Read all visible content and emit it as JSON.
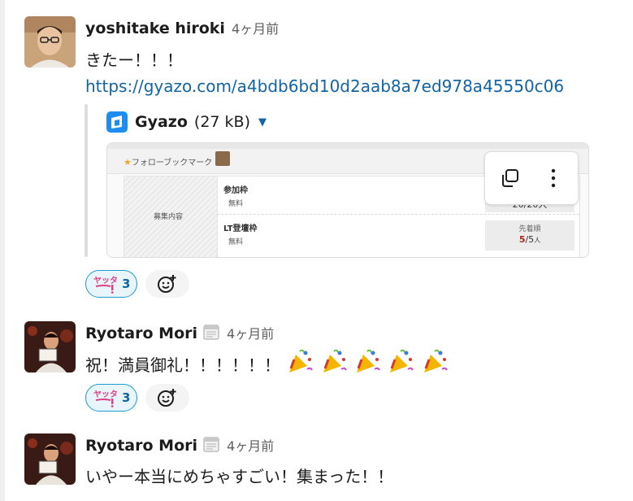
{
  "messages": [
    {
      "author": "yoshitake hiroki",
      "time": "4ヶ月前",
      "text": "きたー！！！",
      "link": "https://gyazo.com/a4bdb6bd10d2aab8a7ed978a45550c06",
      "attachment": {
        "service": "Gyazo",
        "size": "(27 kB)",
        "preview": {
          "favorite_label": "フォローブックマーク",
          "left_label": "募集内容",
          "rows": [
            {
              "title": "参加枠",
              "sub": "無料",
              "count_partial": "20/20人"
            },
            {
              "title": "LT登壇枠",
              "sub": "無料",
              "box_label": "先着順",
              "count_filled": "5",
              "count_total": "/5",
              "count_unit": "人"
            }
          ]
        }
      },
      "reaction": {
        "name": "ヤッタ",
        "count": "3"
      }
    },
    {
      "author": "Ryotaro Mori",
      "time": "4ヶ月前",
      "status_icon": "calendar-icon",
      "text": "祝！満員御礼！！！！！！",
      "emoji_trailing": "party-popper x5",
      "reaction": {
        "name": "ヤッタ",
        "count": "3"
      }
    },
    {
      "author": "Ryotaro Mori",
      "time": "4ヶ月前",
      "status_icon": "calendar-icon",
      "text": "いやー本当にめちゃすごい！集まった！！"
    }
  ],
  "colors": {
    "link": "#1264a3",
    "reaction_border": "#1d9bd1",
    "reaction_bg": "#e8f5fa",
    "muted": "#616061"
  }
}
